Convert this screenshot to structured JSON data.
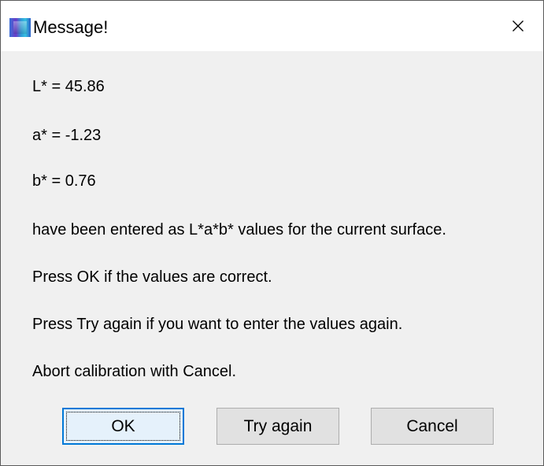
{
  "window": {
    "title": "Message!",
    "close_glyph": "✕"
  },
  "message": {
    "lines": [
      "L* = 45.86",
      "a* = -1.23",
      "b* = 0.76",
      "have been entered as L*a*b* values for the current surface.",
      "Press OK if the values are correct.",
      "Press Try again if you want to enter the values again.",
      "Abort calibration with Cancel."
    ]
  },
  "buttons": {
    "ok_label": "OK",
    "try_again_label": "Try again",
    "cancel_label": "Cancel"
  },
  "colors": {
    "titlebar_bg": "#ffffff",
    "dialog_bg": "#f0f0f0",
    "default_button_border": "#0078d7",
    "button_bg": "#e1e1e1"
  },
  "icons": {
    "app": "app-icon",
    "close": "close-icon"
  }
}
